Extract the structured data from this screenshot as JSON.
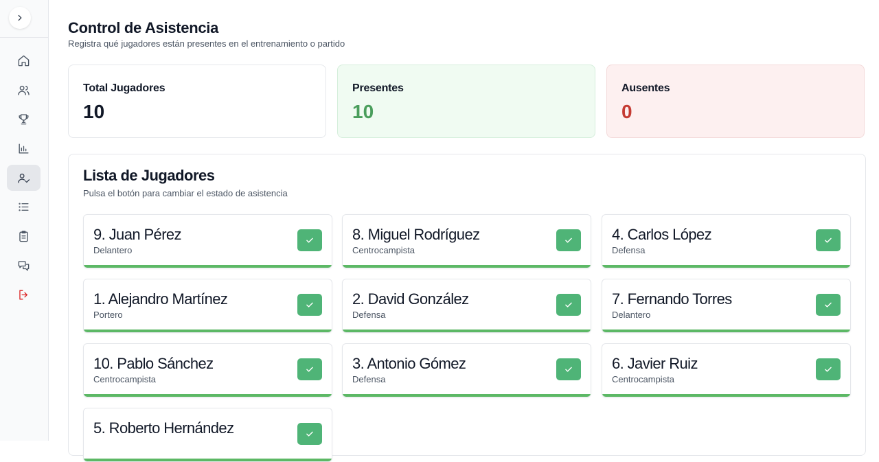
{
  "page": {
    "title": "Control de Asistencia",
    "subtitle": "Registra qué jugadores están presentes en el entrenamiento o partido"
  },
  "sidebar": {
    "items": [
      {
        "icon": "home-icon"
      },
      {
        "icon": "users-icon"
      },
      {
        "icon": "trophy-icon"
      },
      {
        "icon": "bar-chart-icon"
      },
      {
        "icon": "user-check-icon",
        "active": true
      },
      {
        "icon": "list-icon"
      },
      {
        "icon": "clipboard-icon"
      },
      {
        "icon": "messages-icon"
      },
      {
        "icon": "logout-icon",
        "color": "#dc2626"
      }
    ]
  },
  "stats": {
    "total_label": "Total Jugadores",
    "total_value": "10",
    "present_label": "Presentes",
    "present_value": "10",
    "absent_label": "Ausentes",
    "absent_value": "0"
  },
  "player_list": {
    "title": "Lista de Jugadores",
    "subtitle": "Pulsa el botón para cambiar el estado de asistencia",
    "players": [
      {
        "name": "9. Juan Pérez",
        "position": "Delantero",
        "present": true
      },
      {
        "name": "8. Miguel Rodríguez",
        "position": "Centrocampista",
        "present": true
      },
      {
        "name": "4. Carlos López",
        "position": "Defensa",
        "present": true
      },
      {
        "name": "1. Alejandro Martínez",
        "position": "Portero",
        "present": true
      },
      {
        "name": "2. David González",
        "position": "Defensa",
        "present": true
      },
      {
        "name": "7. Fernando Torres",
        "position": "Delantero",
        "present": true
      },
      {
        "name": "10. Pablo Sánchez",
        "position": "Centrocampista",
        "present": true
      },
      {
        "name": "3. Antonio Gómez",
        "position": "Defensa",
        "present": true
      },
      {
        "name": "6. Javier Ruiz",
        "position": "Centrocampista",
        "present": true
      },
      {
        "name": "5. Roberto Hernández",
        "position": "",
        "present": true
      }
    ]
  },
  "colors": {
    "present_green": "#4fb477",
    "present_text": "#4a9e5c",
    "absent_text": "#c53b33"
  }
}
